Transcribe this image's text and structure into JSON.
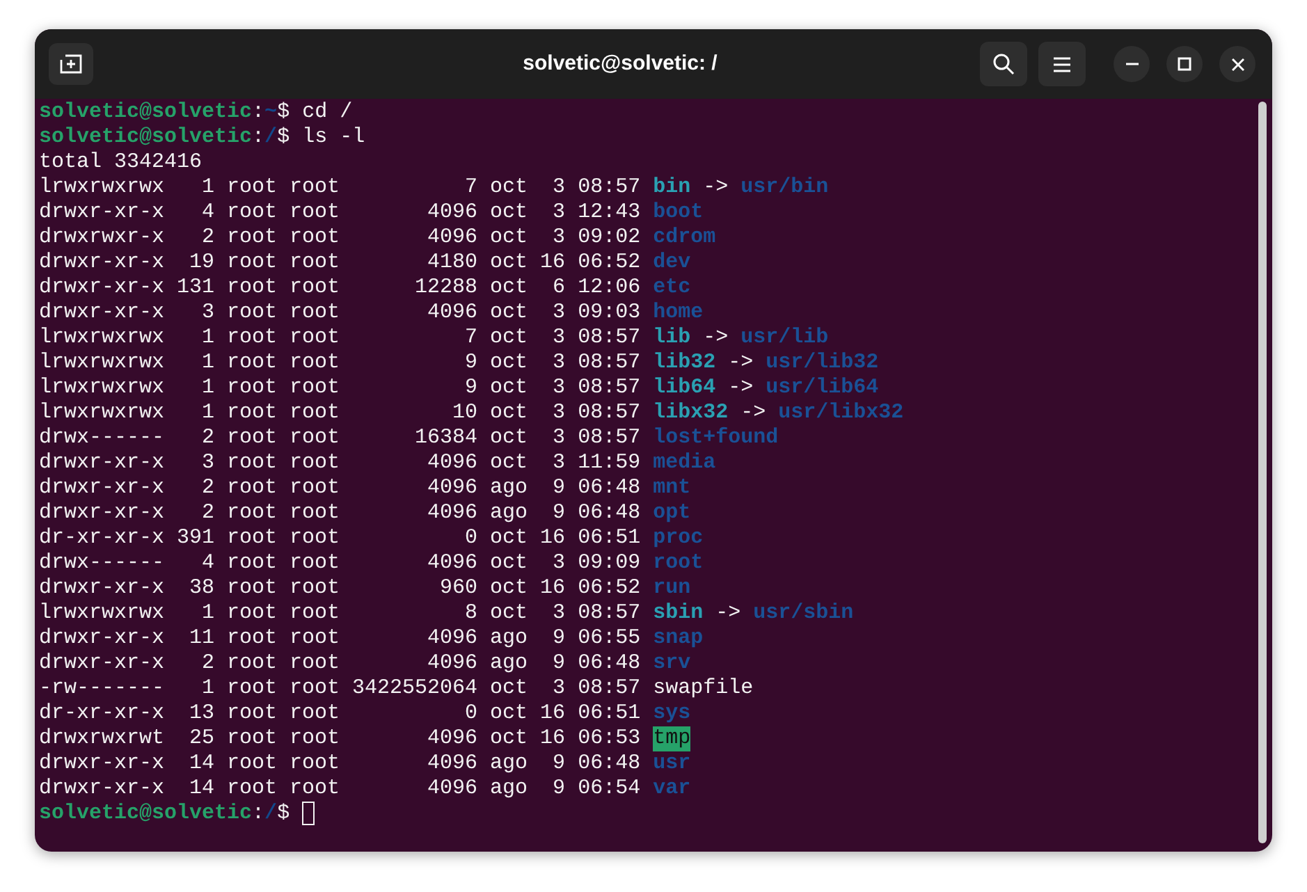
{
  "window": {
    "title": "solvetic@solvetic: /"
  },
  "terminal": {
    "lines": [
      {
        "segments": [
          {
            "kind": "user",
            "text": "solvetic@solvetic"
          },
          {
            "kind": "plain",
            "text": ":"
          },
          {
            "kind": "path",
            "text": "~"
          },
          {
            "kind": "plain",
            "text": "$ cd /"
          }
        ]
      },
      {
        "segments": [
          {
            "kind": "user",
            "text": "solvetic@solvetic"
          },
          {
            "kind": "plain",
            "text": ":"
          },
          {
            "kind": "path",
            "text": "/"
          },
          {
            "kind": "plain",
            "text": "$ ls -l"
          }
        ]
      },
      {
        "segments": [
          {
            "kind": "plain",
            "text": "total 3342416"
          }
        ]
      },
      {
        "segments": [
          {
            "kind": "plain",
            "text": "lrwxrwxrwx   1 root root          7 oct  3 08:57 "
          },
          {
            "kind": "link",
            "text": "bin"
          },
          {
            "kind": "plain",
            "text": " -> "
          },
          {
            "kind": "dir",
            "text": "usr/bin"
          }
        ]
      },
      {
        "segments": [
          {
            "kind": "plain",
            "text": "drwxr-xr-x   4 root root       4096 oct  3 12:43 "
          },
          {
            "kind": "dir",
            "text": "boot"
          }
        ]
      },
      {
        "segments": [
          {
            "kind": "plain",
            "text": "drwxrwxr-x   2 root root       4096 oct  3 09:02 "
          },
          {
            "kind": "dir",
            "text": "cdrom"
          }
        ]
      },
      {
        "segments": [
          {
            "kind": "plain",
            "text": "drwxr-xr-x  19 root root       4180 oct 16 06:52 "
          },
          {
            "kind": "dir",
            "text": "dev"
          }
        ]
      },
      {
        "segments": [
          {
            "kind": "plain",
            "text": "drwxr-xr-x 131 root root      12288 oct  6 12:06 "
          },
          {
            "kind": "dir",
            "text": "etc"
          }
        ]
      },
      {
        "segments": [
          {
            "kind": "plain",
            "text": "drwxr-xr-x   3 root root       4096 oct  3 09:03 "
          },
          {
            "kind": "dir",
            "text": "home"
          }
        ]
      },
      {
        "segments": [
          {
            "kind": "plain",
            "text": "lrwxrwxrwx   1 root root          7 oct  3 08:57 "
          },
          {
            "kind": "link",
            "text": "lib"
          },
          {
            "kind": "plain",
            "text": " -> "
          },
          {
            "kind": "dir",
            "text": "usr/lib"
          }
        ]
      },
      {
        "segments": [
          {
            "kind": "plain",
            "text": "lrwxrwxrwx   1 root root          9 oct  3 08:57 "
          },
          {
            "kind": "link",
            "text": "lib32"
          },
          {
            "kind": "plain",
            "text": " -> "
          },
          {
            "kind": "dir",
            "text": "usr/lib32"
          }
        ]
      },
      {
        "segments": [
          {
            "kind": "plain",
            "text": "lrwxrwxrwx   1 root root          9 oct  3 08:57 "
          },
          {
            "kind": "link",
            "text": "lib64"
          },
          {
            "kind": "plain",
            "text": " -> "
          },
          {
            "kind": "dir",
            "text": "usr/lib64"
          }
        ]
      },
      {
        "segments": [
          {
            "kind": "plain",
            "text": "lrwxrwxrwx   1 root root         10 oct  3 08:57 "
          },
          {
            "kind": "link",
            "text": "libx32"
          },
          {
            "kind": "plain",
            "text": " -> "
          },
          {
            "kind": "dir",
            "text": "usr/libx32"
          }
        ]
      },
      {
        "segments": [
          {
            "kind": "plain",
            "text": "drwx------   2 root root      16384 oct  3 08:57 "
          },
          {
            "kind": "dir",
            "text": "lost+found"
          }
        ]
      },
      {
        "segments": [
          {
            "kind": "plain",
            "text": "drwxr-xr-x   3 root root       4096 oct  3 11:59 "
          },
          {
            "kind": "dir",
            "text": "media"
          }
        ]
      },
      {
        "segments": [
          {
            "kind": "plain",
            "text": "drwxr-xr-x   2 root root       4096 ago  9 06:48 "
          },
          {
            "kind": "dir",
            "text": "mnt"
          }
        ]
      },
      {
        "segments": [
          {
            "kind": "plain",
            "text": "drwxr-xr-x   2 root root       4096 ago  9 06:48 "
          },
          {
            "kind": "dir",
            "text": "opt"
          }
        ]
      },
      {
        "segments": [
          {
            "kind": "plain",
            "text": "dr-xr-xr-x 391 root root          0 oct 16 06:51 "
          },
          {
            "kind": "dir",
            "text": "proc"
          }
        ]
      },
      {
        "segments": [
          {
            "kind": "plain",
            "text": "drwx------   4 root root       4096 oct  3 09:09 "
          },
          {
            "kind": "dir",
            "text": "root"
          }
        ]
      },
      {
        "segments": [
          {
            "kind": "plain",
            "text": "drwxr-xr-x  38 root root        960 oct 16 06:52 "
          },
          {
            "kind": "dir",
            "text": "run"
          }
        ]
      },
      {
        "segments": [
          {
            "kind": "plain",
            "text": "lrwxrwxrwx   1 root root          8 oct  3 08:57 "
          },
          {
            "kind": "link",
            "text": "sbin"
          },
          {
            "kind": "plain",
            "text": " -> "
          },
          {
            "kind": "dir",
            "text": "usr/sbin"
          }
        ]
      },
      {
        "segments": [
          {
            "kind": "plain",
            "text": "drwxr-xr-x  11 root root       4096 ago  9 06:55 "
          },
          {
            "kind": "dir",
            "text": "snap"
          }
        ]
      },
      {
        "segments": [
          {
            "kind": "plain",
            "text": "drwxr-xr-x   2 root root       4096 ago  9 06:48 "
          },
          {
            "kind": "dir",
            "text": "srv"
          }
        ]
      },
      {
        "segments": [
          {
            "kind": "plain",
            "text": "-rw-------   1 root root 3422552064 oct  3 08:57 swapfile"
          }
        ]
      },
      {
        "segments": [
          {
            "kind": "plain",
            "text": "dr-xr-xr-x  13 root root          0 oct 16 06:51 "
          },
          {
            "kind": "dir",
            "text": "sys"
          }
        ]
      },
      {
        "segments": [
          {
            "kind": "plain",
            "text": "drwxrwxrwt  25 root root       4096 oct 16 06:53 "
          },
          {
            "kind": "sticky",
            "text": "tmp"
          }
        ]
      },
      {
        "segments": [
          {
            "kind": "plain",
            "text": "drwxr-xr-x  14 root root       4096 ago  9 06:48 "
          },
          {
            "kind": "dir",
            "text": "usr"
          }
        ]
      },
      {
        "segments": [
          {
            "kind": "plain",
            "text": "drwxr-xr-x  14 root root       4096 ago  9 06:54 "
          },
          {
            "kind": "dir",
            "text": "var"
          }
        ]
      },
      {
        "segments": [
          {
            "kind": "user",
            "text": "solvetic@solvetic"
          },
          {
            "kind": "plain",
            "text": ":"
          },
          {
            "kind": "path",
            "text": "/"
          },
          {
            "kind": "plain",
            "text": "$ "
          }
        ],
        "cursor": true
      }
    ]
  }
}
